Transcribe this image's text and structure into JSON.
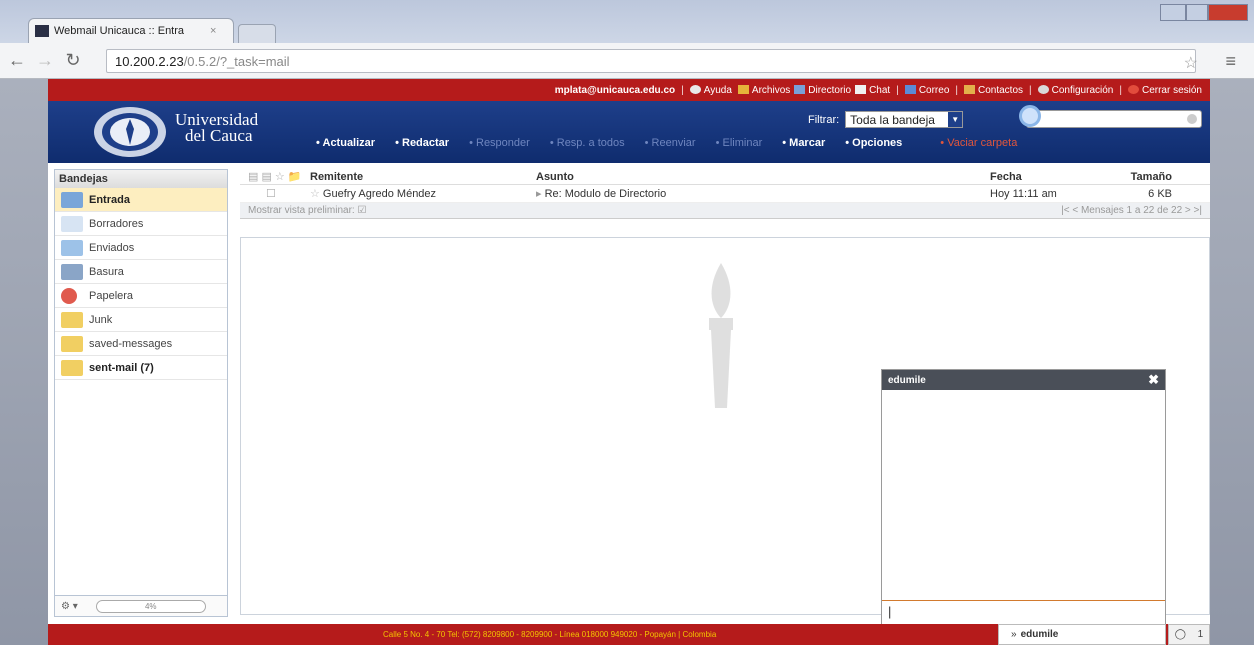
{
  "browser": {
    "tab_title": "Webmail Unicauca :: Entra",
    "tab_close": "×",
    "url_host": "10.200.2.23",
    "url_path": "/0.5.2/?_task=mail"
  },
  "topbar": {
    "email": "mplata@unicauca.edu.co",
    "links": [
      "Ayuda",
      "Archivos",
      "Directorio",
      "Chat",
      "Correo",
      "Contactos",
      "Configuración",
      "Cerrar sesión"
    ],
    "separator": "|"
  },
  "header": {
    "univ_line1": "Universidad",
    "univ_line2": "del Cauca",
    "filter_label": "Filtrar:",
    "filter_value": "Toda la bandeja",
    "actions": [
      "Actualizar",
      "Redactar",
      "Responder",
      "Resp. a todos",
      "Reenviar",
      "Eliminar",
      "Marcar",
      "Opciones"
    ],
    "empty_trash": "Vaciar carpeta"
  },
  "sidebar": {
    "title": "Bandejas",
    "folders": [
      {
        "label": "Entrada"
      },
      {
        "label": "Borradores"
      },
      {
        "label": "Enviados"
      },
      {
        "label": "Basura"
      },
      {
        "label": "Papelera"
      },
      {
        "label": "Junk"
      },
      {
        "label": "saved-messages"
      },
      {
        "label": "sent-mail (7)"
      }
    ],
    "quota": "4%",
    "gear": "⚙ ▾"
  },
  "list": {
    "col_sender": "Remitente",
    "col_subject": "Asunto",
    "col_date": "Fecha",
    "col_size": "Tamaño",
    "row": {
      "sender": "Guefry Agredo Méndez",
      "subject": "Re: Modulo de Directorio",
      "date": "Hoy 11:11 am",
      "size": "6 KB"
    },
    "preview_label": "Mostrar vista preliminar:",
    "paging": "Mensajes 1 a 22 de 22"
  },
  "chat": {
    "title": "edumile",
    "close": "✖",
    "input_value": "|",
    "dock_name": "edumile",
    "dock_bullet": "»"
  },
  "footer": {
    "text": "Calle 5 No. 4 - 70 Tel: (572) 8209800 - 8209900 - Línea 018000 949020 - Popayán | Colombia"
  }
}
